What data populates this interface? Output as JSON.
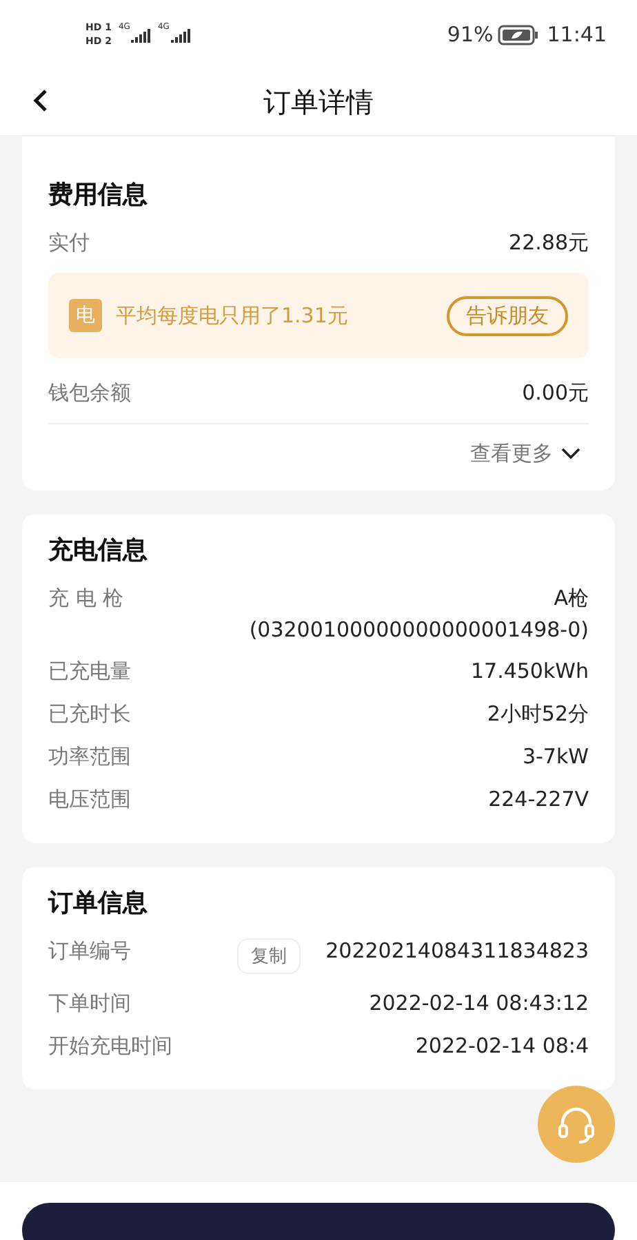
{
  "status_bar": {
    "sim_1": "HD 1",
    "sim_2": "HD 2",
    "network_1": "4G",
    "network_2": "4G",
    "battery": "91%",
    "time": "11:41"
  },
  "header": {
    "title": "订单详情"
  },
  "fee_info": {
    "title": "费用信息",
    "paid_label": "实付",
    "paid_value": "22.88元",
    "promo": {
      "badge": "电",
      "text": "平均每度电只用了1.31元",
      "button": "告诉朋友"
    },
    "wallet_label": "钱包余额",
    "wallet_value": "0.00元",
    "more": "查看更多"
  },
  "charge_info": {
    "title": "充电信息",
    "rows": [
      {
        "label": "充 电 枪",
        "value": "A枪",
        "sub_value": "(03200100000000000001498-0)"
      },
      {
        "label": "已充电量",
        "value": "17.450kWh"
      },
      {
        "label": "已充时长",
        "value": "2小时52分"
      },
      {
        "label": "功率范围",
        "value": "3-7kW"
      },
      {
        "label": "电压范围",
        "value": "224-227V"
      }
    ]
  },
  "order_info": {
    "title": "订单信息",
    "rows": [
      {
        "label": "订单编号",
        "value": "20220214084311834823",
        "action": "复制"
      },
      {
        "label": "下单时间",
        "value": "2022-02-14 08:43:12"
      },
      {
        "label": "开始充电时间",
        "value": "2022-02-14 08:4"
      }
    ]
  }
}
